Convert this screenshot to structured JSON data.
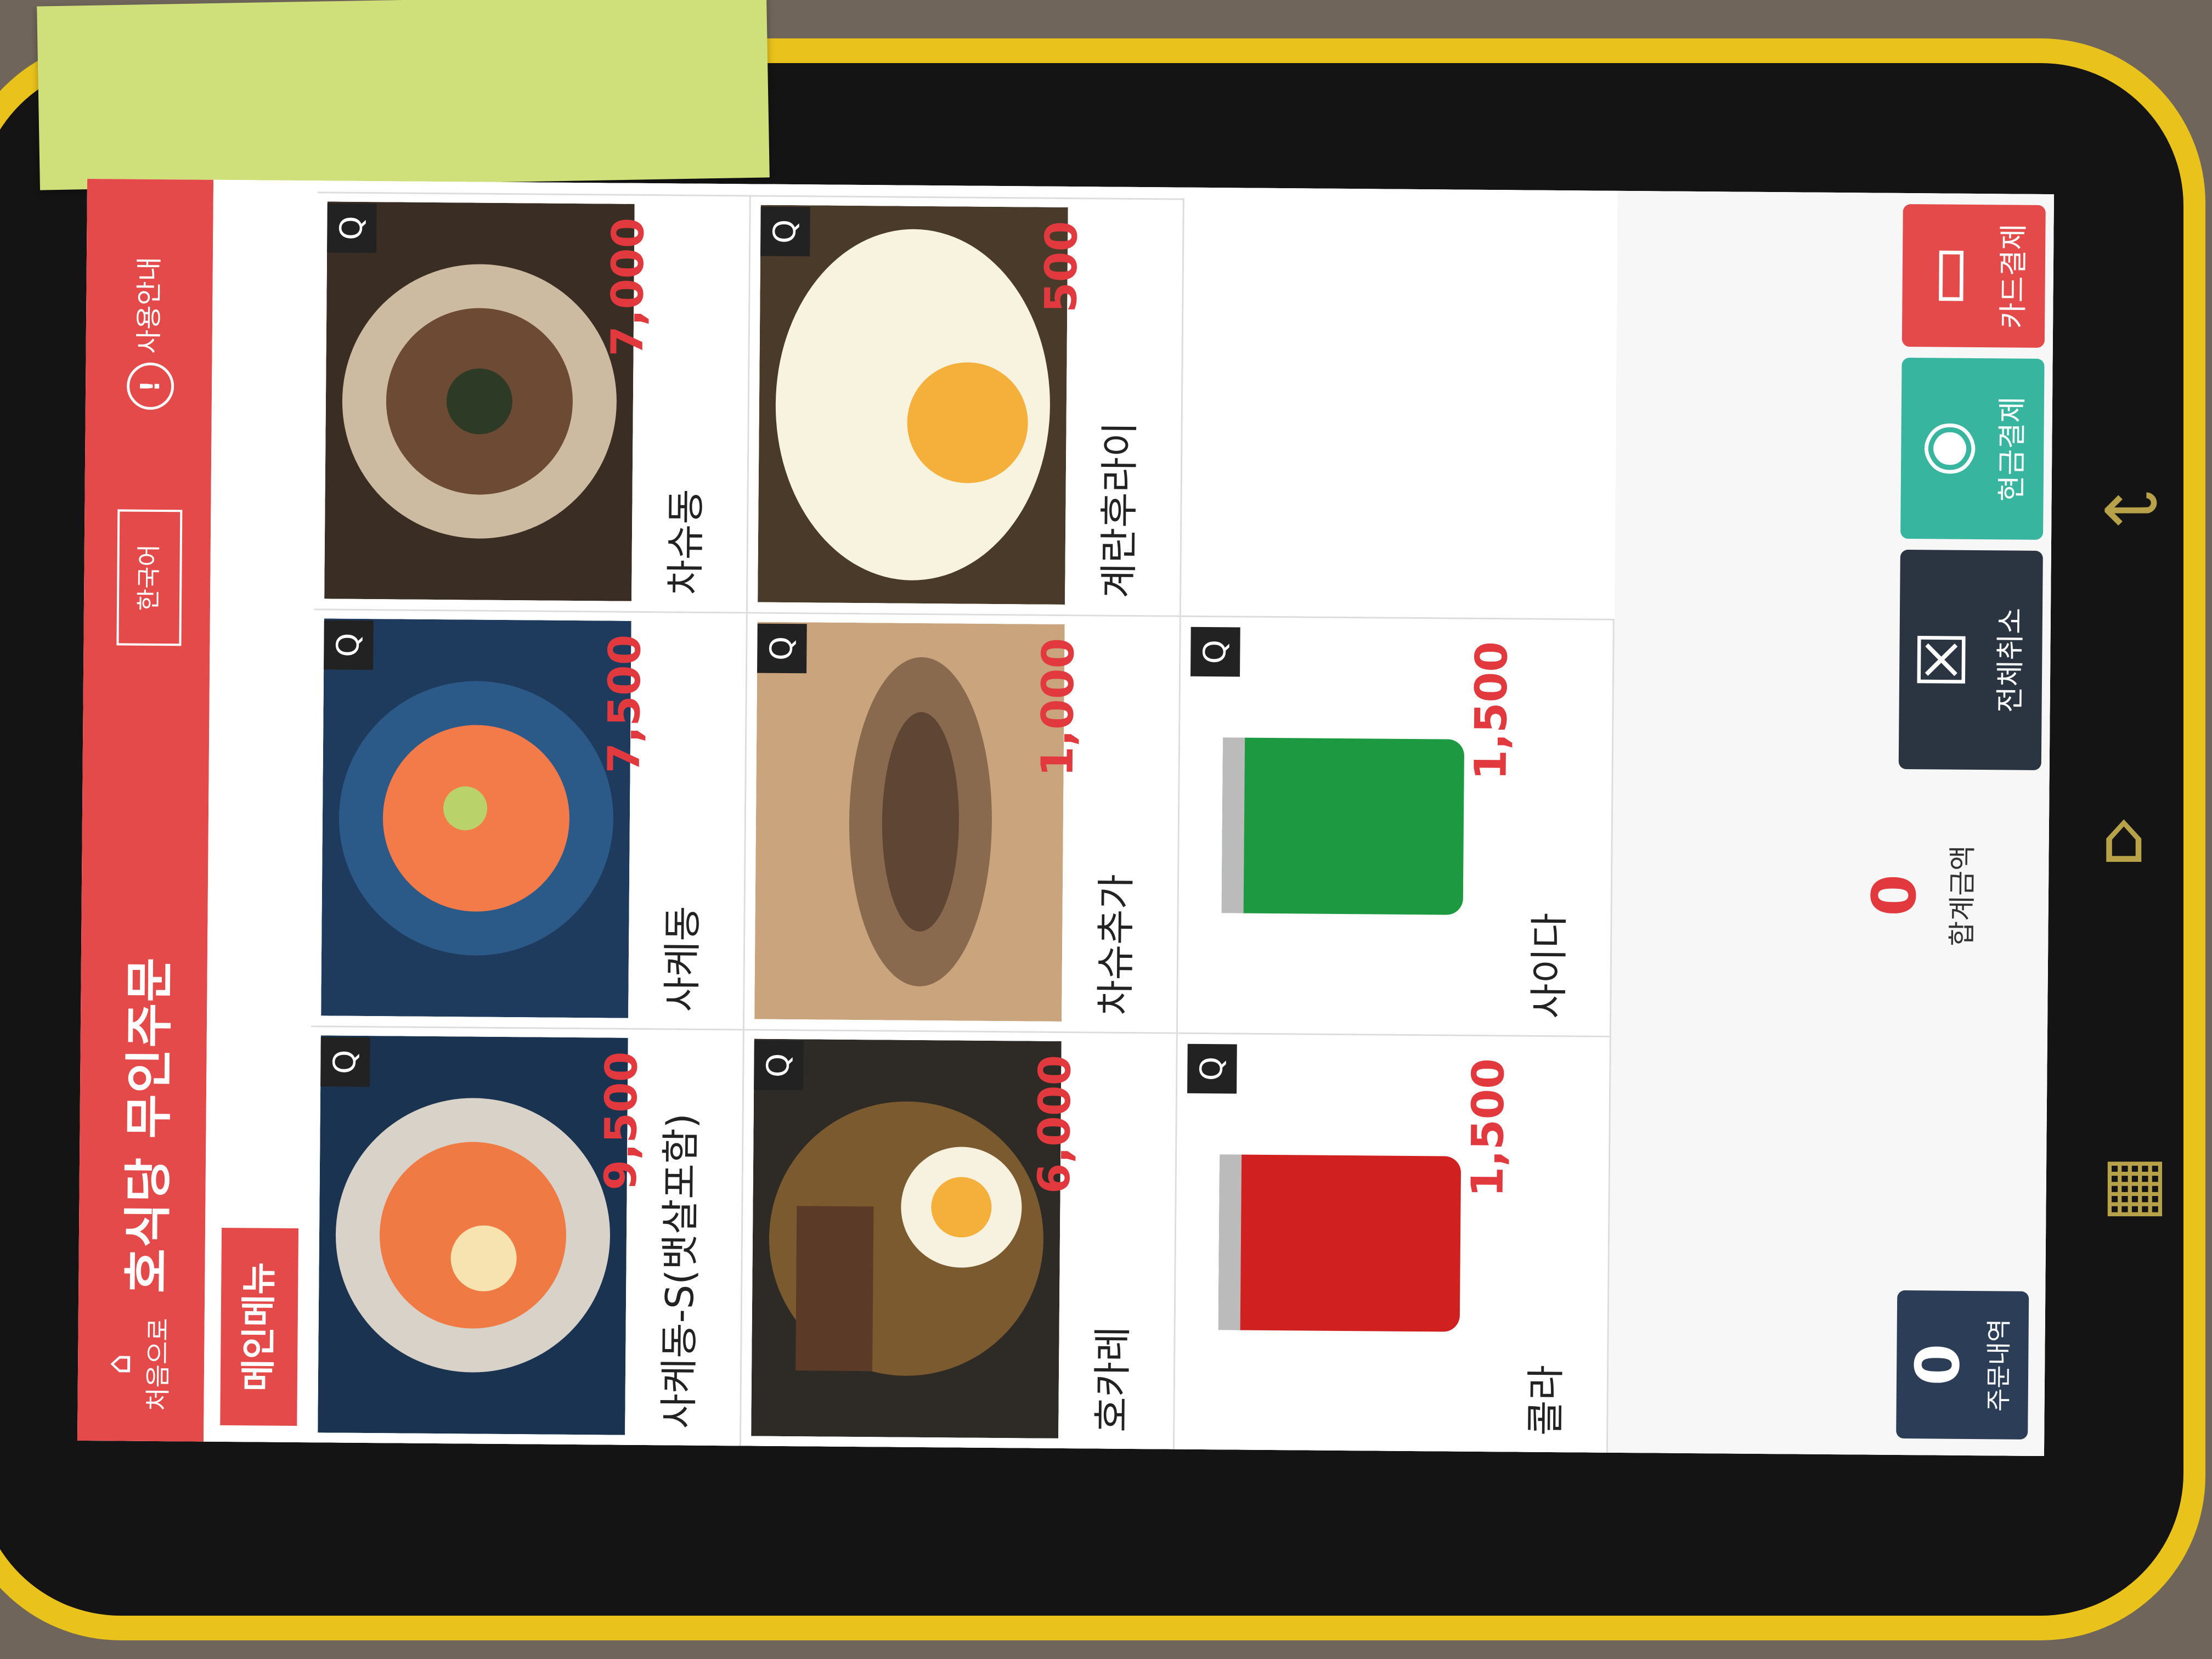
{
  "header": {
    "home_label": "처음으로",
    "title": "호식당 무인주문",
    "language": "한국어",
    "help_label": "사용안내",
    "home_icon": "home-icon",
    "help_icon": "info-icon"
  },
  "tabs": [
    {
      "label": "메인메뉴",
      "active": true
    }
  ],
  "menu": {
    "zoom_glyph": "Q",
    "items": [
      {
        "name": "사케동-S(뱃살포함)",
        "price": "9,500",
        "image": "salmon-don",
        "color": "#f07a44"
      },
      {
        "name": "사케동",
        "price": "7,500",
        "image": "salmon-don",
        "color": "#f27b49"
      },
      {
        "name": "차슈동",
        "price": "7,000",
        "image": "chashu-don",
        "color": "#6d4a33"
      },
      {
        "name": "호카레",
        "price": "6,000",
        "image": "curry-rice",
        "color": "#7b5a2f"
      },
      {
        "name": "차슈추가",
        "price": "1,000",
        "image": "chashu",
        "color": "#8a6a4e"
      },
      {
        "name": "계란후라이",
        "price": "500",
        "image": "fried-egg",
        "color": "#f4b03a"
      },
      {
        "name": "콜라",
        "price": "1,500",
        "image": "cola-can",
        "color": "#d0201f"
      },
      {
        "name": "사이다",
        "price": "1,500",
        "image": "cider-can",
        "color": "#1d9a41"
      }
    ]
  },
  "footer": {
    "order_count": "0",
    "order_label": "주문내역",
    "total_value": "0",
    "total_label": "합계금액",
    "cancel_all": "전체취소",
    "cash_pay": "현금결제",
    "card_pay": "카드결제"
  },
  "colors": {
    "accent": "#e44a4a",
    "price": "#e2393f",
    "cash": "#37b59f",
    "navy": "#2c3e57",
    "bezel": "#e9c21b"
  }
}
